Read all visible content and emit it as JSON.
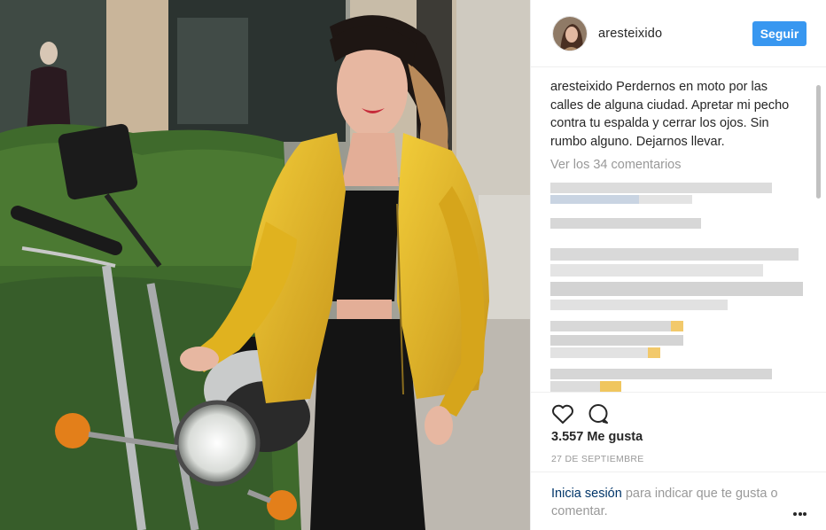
{
  "post": {
    "username": "aresteixido",
    "follow_label": "Seguir",
    "caption_user": "aresteixido",
    "caption_text": "Perdernos en moto por las calles de alguna ciudad. Apretar mi pecho contra tu espalda y cerrar los ojos. Sin rumbo alguno. Dejarnos llevar.",
    "view_comments": "Ver los 34 comentarios",
    "likes": "3.557 Me gusta",
    "date": "27 DE SEPTIEMBRE",
    "login_link": "Inicia sesión",
    "login_rest": " para indicar que te gusta o comentar."
  },
  "icons": {
    "like": "heart-outline-icon",
    "comment": "speech-bubble-icon",
    "more": "ellipsis-icon"
  },
  "colors": {
    "follow_button": "#3897f0",
    "muted_text": "#999999",
    "link": "#003569",
    "jacket": "#e0b21f"
  }
}
